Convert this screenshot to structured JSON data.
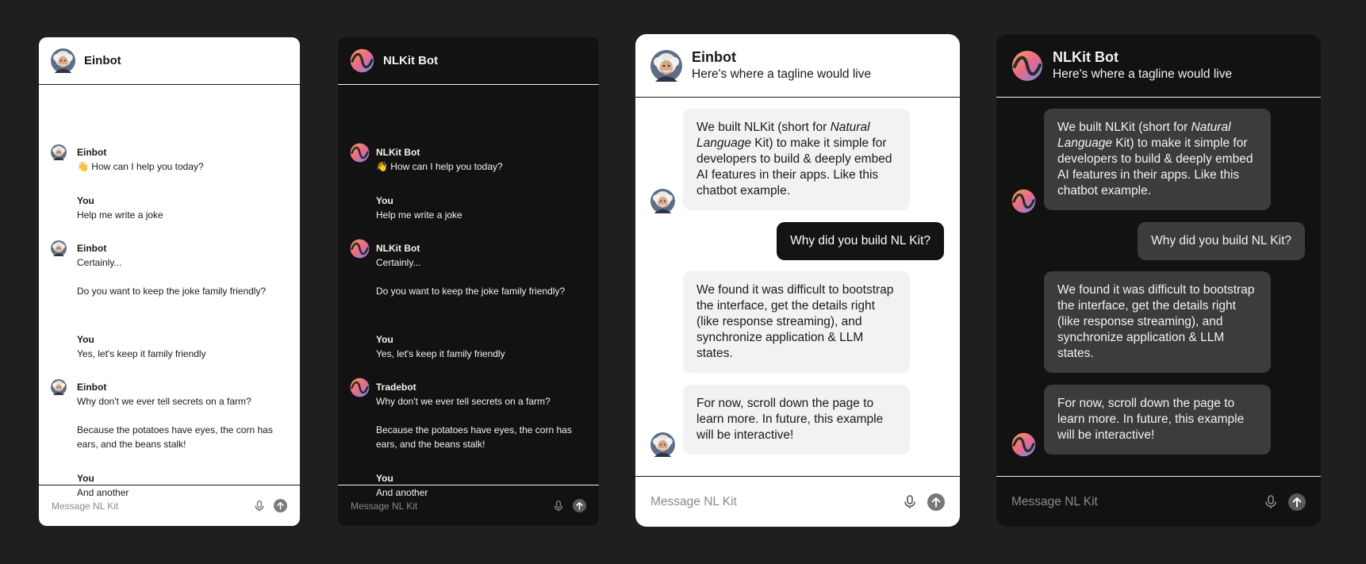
{
  "composer": {
    "placeholder": "Message NL Kit",
    "mic_icon": "mic-icon",
    "send_icon": "send-arrow-icon"
  },
  "card1": {
    "title": "Einbot",
    "messages": [
      {
        "name": "Einbot",
        "lines": [
          "👋 How can I help you today?"
        ]
      },
      {
        "name": "You",
        "lines": [
          "Help me write a joke"
        ]
      },
      {
        "name": "Einbot",
        "lines": [
          "Certainly...",
          "Do you want to keep the joke family friendly?"
        ]
      },
      {
        "name": "You",
        "lines": [
          "Yes, let's keep it family friendly"
        ]
      },
      {
        "name": "Einbot",
        "lines": [
          "Why don't we ever tell secrets on a farm?",
          "Because the potatoes have eyes, the corn has ears, and the beans stalk!"
        ]
      },
      {
        "name": "You",
        "lines": [
          "And another"
        ]
      }
    ]
  },
  "card2": {
    "title": "NLKit Bot",
    "messages": [
      {
        "name": "NLKit Bot",
        "lines": [
          "👋 How can I help you today?"
        ]
      },
      {
        "name": "You",
        "lines": [
          "Help me write a joke"
        ]
      },
      {
        "name": "NLKit Bot",
        "lines": [
          "Certainly...",
          "Do you want to keep the joke family friendly?"
        ]
      },
      {
        "name": "You",
        "lines": [
          "Yes, let's keep it family friendly"
        ]
      },
      {
        "name": "Tradebot",
        "lines": [
          "Why don't we ever tell secrets on a farm?",
          "Because the potatoes have eyes, the corn has ears, and the beans stalk!"
        ]
      },
      {
        "name": "You",
        "lines": [
          "And another"
        ]
      }
    ]
  },
  "card3": {
    "title": "Einbot",
    "tagline": "Here's where a tagline would live",
    "bubbles": {
      "b1_pre": "We built NLKit (short for ",
      "b1_em": "Natural Language",
      "b1_post": " Kit) to make it simple for developers to build & deeply embed AI features in their apps. Like this chatbot example.",
      "user": "Why did you build NL Kit?",
      "b2": "We found it was difficult to bootstrap the interface, get the details right (like response streaming), and synchronize application & LLM states.",
      "b3": "For now, scroll down the page to learn more. In future, this example will be interactive!"
    }
  },
  "card4": {
    "title": "NLKit Bot",
    "tagline": "Here's where a tagline would live",
    "bubbles": {
      "b1_pre": "We built NLKit (short for ",
      "b1_em": "Natural Language",
      "b1_post": " Kit) to make it simple for developers to build & deeply embed AI features in their apps. Like this chatbot example.",
      "user": "Why did you build NL Kit?",
      "b2": "We found it was difficult to bootstrap the interface, get the details right (like response streaming), and synchronize application & LLM states.",
      "b3": "For now, scroll down the page to learn more. In future, this example will be interactive!"
    }
  }
}
